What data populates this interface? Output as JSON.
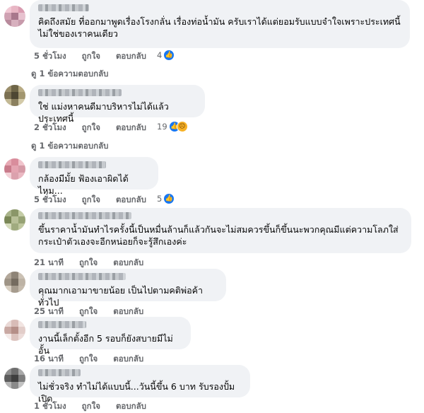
{
  "comments": [
    {
      "text": "คิดถึงสมัย ที่ออกมาพูดเรื่องโรงกลั่น เรื่องท่อน้ำมัน ครับเราได้แต่ยอมรับแบบจำใจเพราะประเทศนี้\nไม่ใช่ของเราคนเดียว",
      "time": "5 ชั่วโมง",
      "like": "ถูกใจ",
      "reply": "ตอบกลับ",
      "reaction_count": "4",
      "replies_label": "ดู 1 ข้อความตอบกลับ"
    },
    {
      "text": "ใช่ แม่งหาคนดีมาบริหารไม่ได้แล้วประเทศนี้",
      "time": "2 ชั่วโมง",
      "like": "ถูกใจ",
      "reply": "ตอบกลับ",
      "reaction_count": "19",
      "replies_label": "ดู 1 ข้อความตอบกลับ"
    },
    {
      "text": "กล้องมีมั้ย ฟ้องเอาผิดได้ไหม...",
      "time": "5 ชั่วโมง",
      "like": "ถูกใจ",
      "reply": "ตอบกลับ",
      "reaction_count": "5"
    },
    {
      "text": "ขึ้นราคาน้ำมันทำไรครั้งนี้เป็นหมื่นล้านก็แล้วกันจะไม่สมควรขึ้นก็ขึ้นนะพวกคุณมีแต่ความโลภใส่\nกระเป๋าตัวเองจะอีกหน่อยก็จะรู้สึกเองค่ะ",
      "time": "21 นาที",
      "like": "ถูกใจ",
      "reply": "ตอบกลับ"
    },
    {
      "text": "คุณมากเอามาขายน้อย เป็นไปตามคติพ่อค้าทั่วไป",
      "time": "25 นาที",
      "like": "ถูกใจ",
      "reply": "ตอบกลับ"
    },
    {
      "text": "งานนี้เล็กตั้งอีก 5 รอบก็ยังสบายมีไม่อั้น",
      "time": "16 นาที",
      "like": "ถูกใจ",
      "reply": "ตอบกลับ"
    },
    {
      "text": "ไม่ชั่วจริง ทำไม่ได้แบบนี้...วันนี้ขึ้น 6 บาท รับรองปั้มเปิด",
      "time": "1 ชั่วโมง",
      "like": "ถูกใจ",
      "reply": "ตอบกลับ"
    }
  ],
  "colors": {
    "bubble": "#f0f2f5",
    "meta": "#65676b",
    "like_badge": "#1877f2",
    "sad_badge": "#f7b125"
  }
}
